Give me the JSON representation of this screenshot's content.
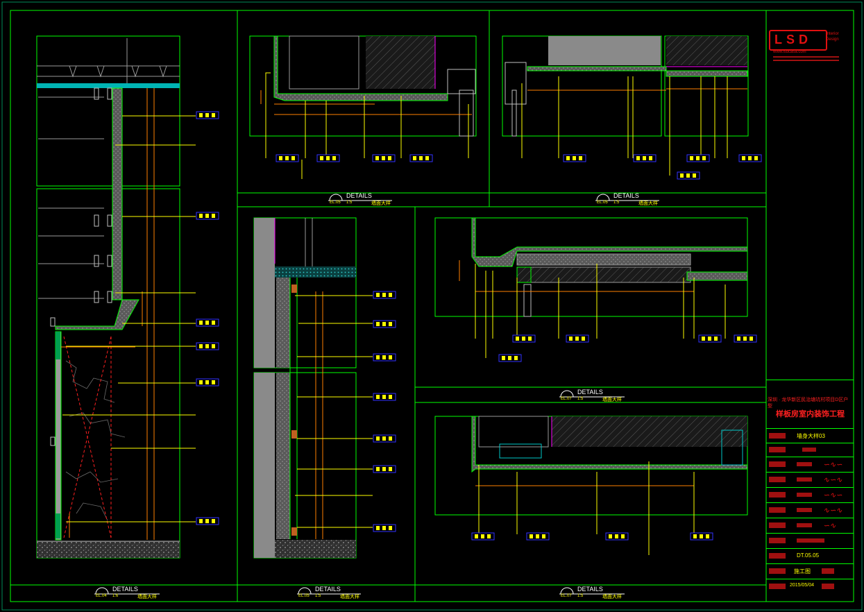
{
  "details_heading": "DETAILS",
  "panels": [
    {
      "id": "p1",
      "ref": "EL.04",
      "scale": "1:6",
      "title": "墙面大样"
    },
    {
      "id": "p2",
      "ref": "EL.05",
      "scale": "1:5",
      "title": "墙面大样"
    },
    {
      "id": "p3",
      "ref": "EL.05",
      "scale": "1:5",
      "title": "墙面大样"
    },
    {
      "id": "p4",
      "ref": "EL.05",
      "scale": "1:5",
      "title": "墙面大样"
    },
    {
      "id": "p5",
      "ref": "EL.07",
      "scale": "1:5",
      "title": "墙面大样"
    },
    {
      "id": "p6",
      "ref": "EL.07",
      "scale": "1:5",
      "title": "墙面大样"
    }
  ],
  "title_block": {
    "logo": "LSD",
    "logo_sub": "Interior Design",
    "website": "www.lsdcasa.com",
    "project_name_line1": "深圳 · 龙华新区民治塘坑村项目D区户型",
    "project_name_line2": "样板房室内装饰工程",
    "drawing_name": "墙身大样03",
    "drawing_no": "DT.05.05",
    "phase": "施工图",
    "date": "2015/05/04"
  },
  "colors": {
    "frame": "#00ff00",
    "frame_dark": "#008c5a",
    "label": "#ffff00",
    "tag_border": "#3030ff",
    "dim": "#ff8000",
    "magenta": "#ff00ff",
    "red": "#ff2020",
    "cyan": "#00c8c8",
    "grey": "#808080"
  }
}
